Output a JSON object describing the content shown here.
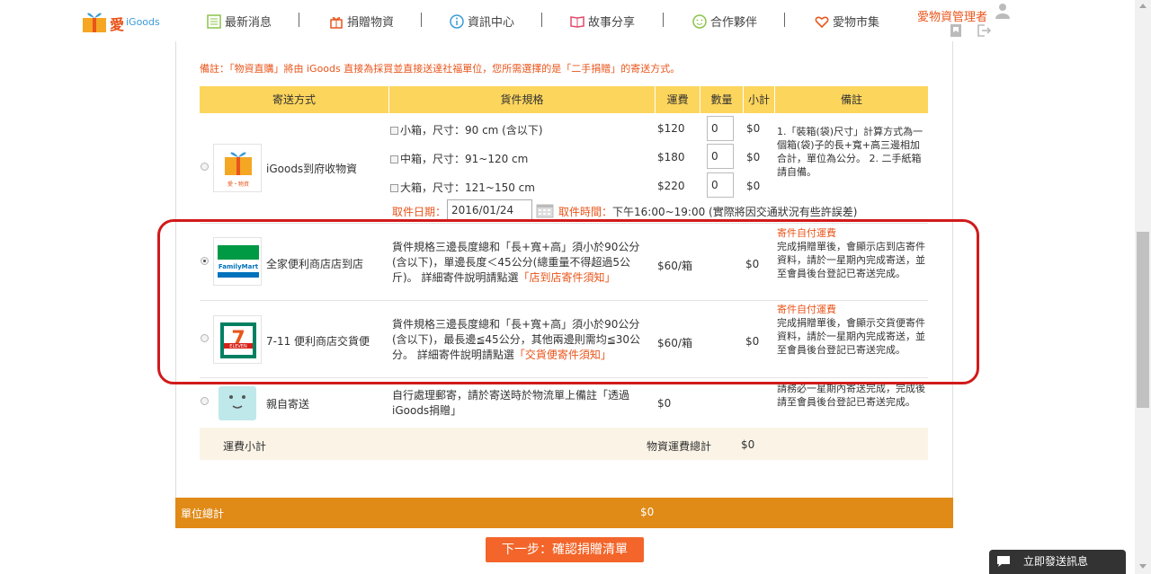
{
  "header": {
    "logo_text": "愛",
    "logo_sub": "iGoods",
    "nav": [
      {
        "label": "最新消息",
        "icon": "list-icon"
      },
      {
        "label": "捐贈物資",
        "icon": "gift-icon"
      },
      {
        "label": "資訊中心",
        "icon": "info-icon"
      },
      {
        "label": "故事分享",
        "icon": "book-icon"
      },
      {
        "label": "合作夥伴",
        "icon": "smile-icon"
      },
      {
        "label": "愛物市集",
        "icon": "heart-icon"
      }
    ],
    "admin_label": "愛物資管理者"
  },
  "note": "備註：「物資直購」將由 iGoods 直接為採買並直接送達社福單位，您所需選擇的是「二手捐贈」的寄送方式。",
  "table": {
    "headers": [
      "寄送方式",
      "貨件規格",
      "運費",
      "數量",
      "小計",
      "備註"
    ],
    "rows": {
      "igoods": {
        "name": "iGoods到府收物資",
        "thumb_text": "愛・物資",
        "specs": [
          {
            "label": "小箱，尺寸：90 cm (含以下)",
            "fee": "$120",
            "qty": "0",
            "subtotal": "$0"
          },
          {
            "label": "中箱，尺寸：91~120 cm",
            "fee": "$180",
            "qty": "0",
            "subtotal": "$0"
          },
          {
            "label": "大箱，尺寸：121~150 cm",
            "fee": "$220",
            "qty": "0",
            "subtotal": "$0"
          }
        ],
        "remark": "1.「裝箱(袋)尺寸」計算方式為一個箱(袋)子的長+寬+高三邊相加合計，單位為公分。 2. 二手紙箱請自備。",
        "pickup_date_label": "取件日期：",
        "pickup_date_value": "2016/01/24",
        "pickup_time_label": "取件時間：",
        "pickup_time_value": "下午16:00~19:00 (實際將因交通狀況有些許誤差)"
      },
      "familymart": {
        "name": "全家便利商店店到店",
        "thumb_text": "FamilyMart",
        "spec": "貨件規格三邊長度總和「長+寬+高」須小於90公分(含以下)，單邊長度＜45公分(總重量不得超過5公斤)。 詳細寄件說明請點選",
        "spec_link": "「店到店寄件須知」",
        "fee": "$60/箱",
        "subtotal": "$0",
        "remark_title": "寄件自付運費",
        "remark": "完成捐贈單後，會顯示店到店寄件資料，請於一星期內完成寄送，並至會員後台登記已寄送完成。"
      },
      "seven": {
        "name": "7-11 便利商店交貨便",
        "thumb_text": "ELEVEN",
        "spec": "貨件規格三邊長度總和「長+寬+高」須小於90公分(含以下)，最長邊≦45公分，其他兩邊則需均≦30公分。 詳細寄件說明請點選",
        "spec_link": "「交貨便寄件須知」",
        "fee": "$60/箱",
        "subtotal": "$0",
        "remark_title": "寄件自付運費",
        "remark": "完成捐贈單後，會顯示交貨便寄件資料，請於一星期內完成寄送，並至會員後台登記已寄送完成。"
      },
      "self": {
        "name": "親自寄送",
        "spec": "自行處理郵寄，請於寄送時於物流單上備註「透過iGoods捐贈」",
        "fee": "$0",
        "remark": "請務必一星期內寄送完成，完成後請至會員後台登記已寄送完成。"
      }
    },
    "subtotal_label": "運費小計",
    "total_shipping_label": "物資運費總計",
    "total_shipping_value": "$0"
  },
  "unit_total_label": "單位總計",
  "unit_total_value": "$0",
  "next_button": "下一步：確認捐贈清單",
  "chat_button": "立即發送訊息",
  "colors": {
    "accent": "#e9551b",
    "header_bg": "#fcd55c",
    "total_bar": "#e08a18",
    "highlight": "#d11a1a"
  }
}
